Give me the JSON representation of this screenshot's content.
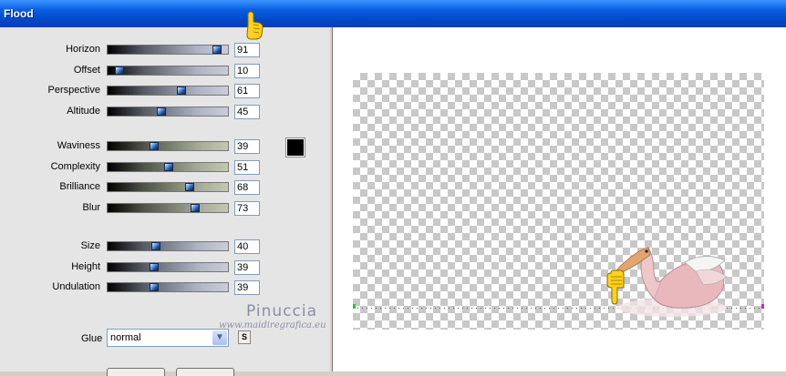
{
  "window": {
    "title": "Flood"
  },
  "params_a": [
    {
      "label": "Horizon",
      "value": "91",
      "level": 0.91
    },
    {
      "label": "Offset",
      "value": "10",
      "level": 0.1
    },
    {
      "label": "Perspective",
      "value": "61",
      "level": 0.61
    },
    {
      "label": "Altitude",
      "value": "45",
      "level": 0.45
    }
  ],
  "params_b": [
    {
      "label": "Waviness",
      "value": "39",
      "level": 0.39
    },
    {
      "label": "Complexity",
      "value": "51",
      "level": 0.51
    },
    {
      "label": "Brilliance",
      "value": "68",
      "level": 0.68
    },
    {
      "label": "Blur",
      "value": "73",
      "level": 0.73
    }
  ],
  "params_c": [
    {
      "label": "Size",
      "value": "40",
      "level": 0.4
    },
    {
      "label": "Height",
      "value": "39",
      "level": 0.39
    },
    {
      "label": "Undulation",
      "value": "39",
      "level": 0.39
    }
  ],
  "color_swatch": {
    "color": "#000000"
  },
  "glue": {
    "label": "Glue",
    "value": "normal",
    "swatch_button": "S"
  },
  "watermark": {
    "line1": "Pinuccia",
    "line2": "www.maidiregrafica.eu"
  },
  "icons": [
    "pointing-hand-icon",
    "chevron-down-icon",
    "pelican-image"
  ]
}
